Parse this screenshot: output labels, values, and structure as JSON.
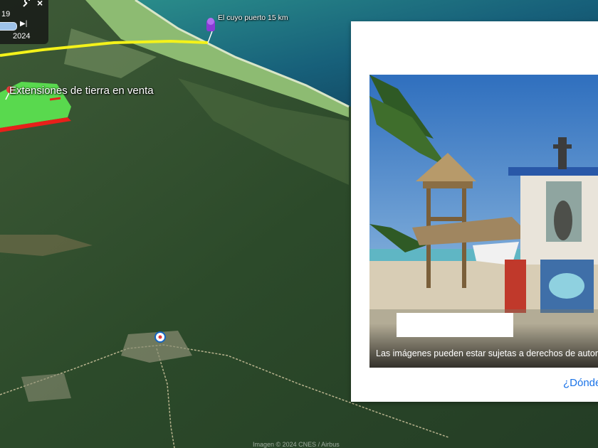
{
  "map": {
    "time_widget": {
      "year_start": "19",
      "year_end": "2024"
    },
    "labels": {
      "land_sale": "Extensiones de tierra en venta",
      "port": "El cuyo puerto 15 km"
    },
    "copyright": "Imagen © 2024 CNES / Airbus"
  },
  "popup": {
    "caption": "Las imágenes pueden estar sujetas a derechos de autor.",
    "link": "¿Dónde"
  },
  "colors": {
    "path_yellow": "#f4f21a",
    "polygon_green": "#59d94e",
    "polygon_red_edge": "#e8201a",
    "pin_purple": "#8a3bd6",
    "pin_red": "#e23b3b",
    "link_blue": "#1a73e8"
  }
}
